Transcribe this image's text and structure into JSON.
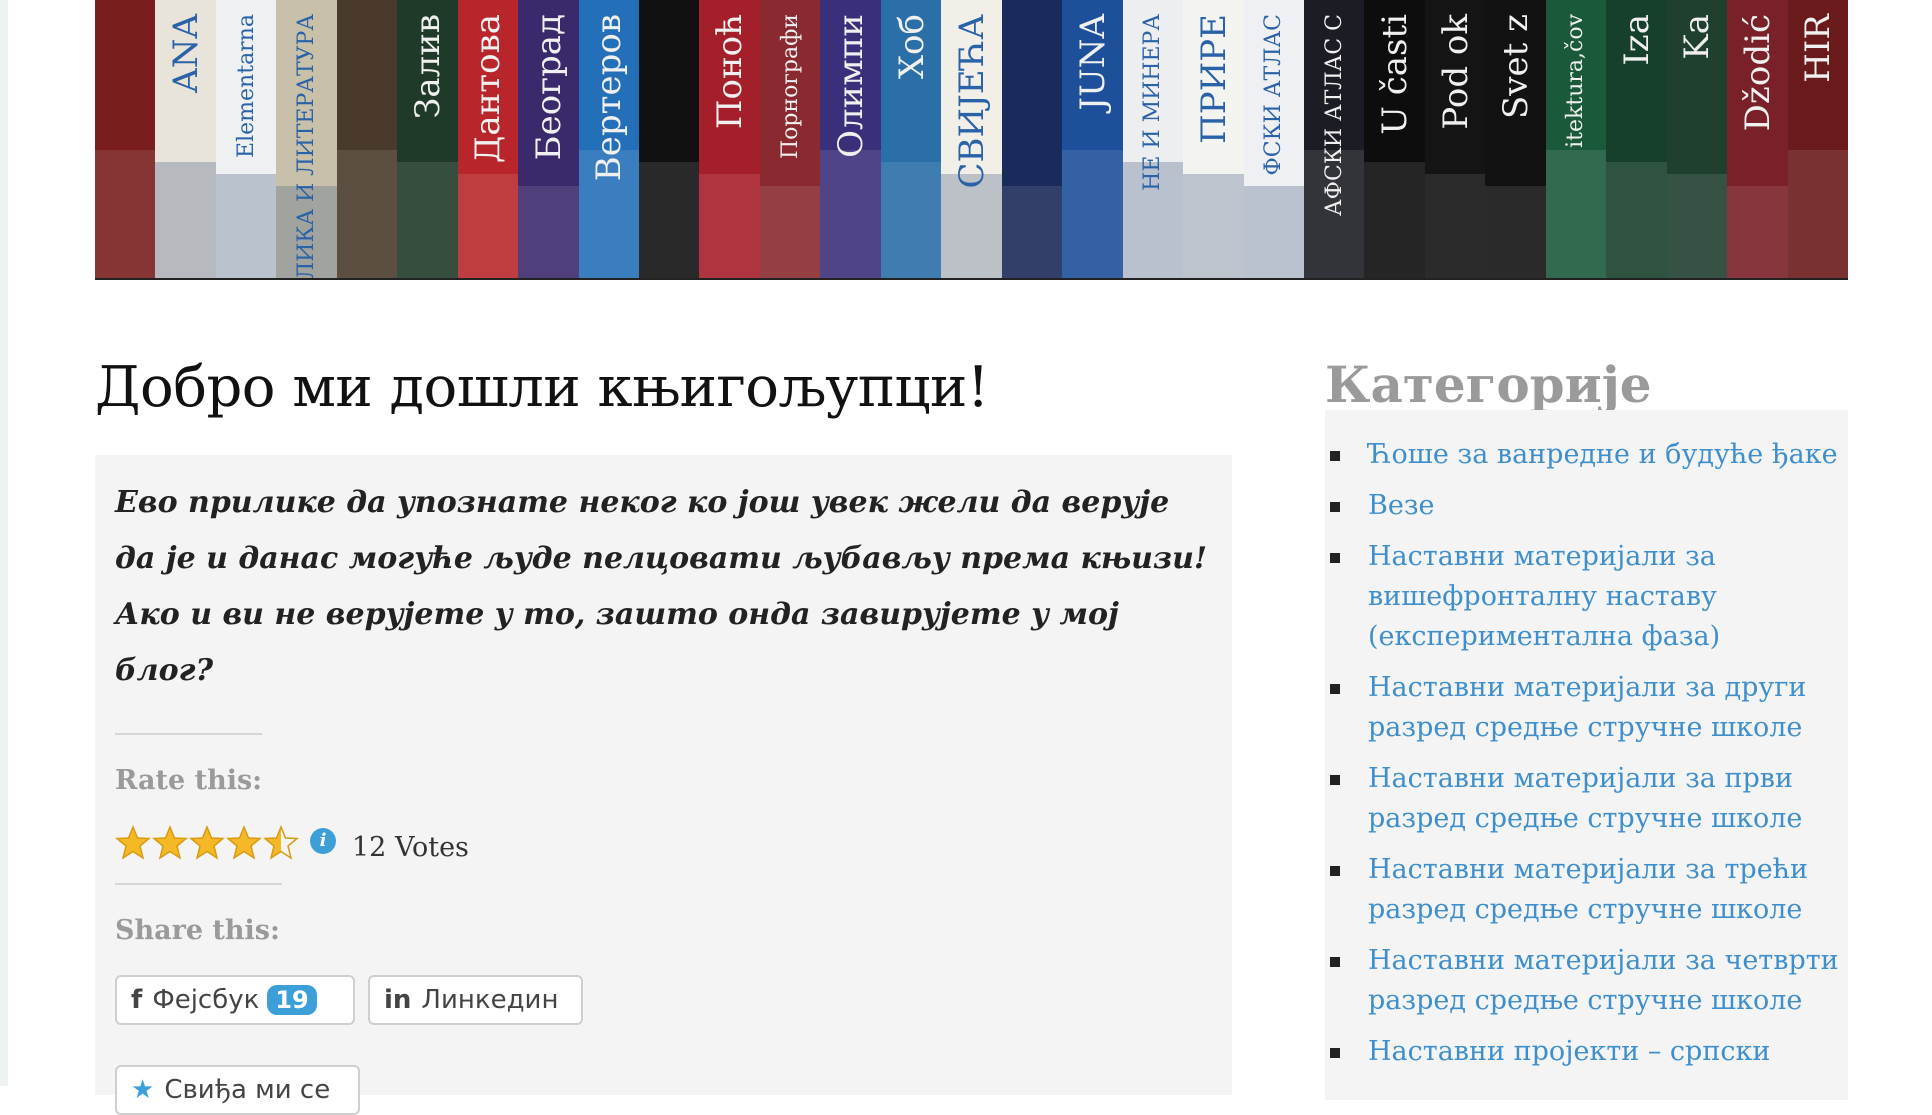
{
  "header": {
    "banner_alt": "book spines",
    "spines": [
      {
        "color": "#7a1d1d",
        "text": ""
      },
      {
        "color": "#e8e4da",
        "text": "ANA"
      },
      {
        "color": "#eef0f2",
        "text": "Elementarna"
      },
      {
        "color": "#c8c0a8",
        "text": "ЛИКА И ЛИТЕРАТУРА"
      },
      {
        "color": "#4a3a2c",
        "text": ""
      },
      {
        "color": "#1f3a28",
        "text": "Залив"
      },
      {
        "color": "#b8262b",
        "text": "Дантова"
      },
      {
        "color": "#3b2a6b",
        "text": "Београд"
      },
      {
        "color": "#2470b8",
        "text": "Вертеров"
      },
      {
        "color": "#111111",
        "text": ""
      },
      {
        "color": "#a51f2a",
        "text": "Поноћ"
      },
      {
        "color": "#8a2a30",
        "text": "Порнографи"
      },
      {
        "color": "#3a2f7a",
        "text": "Олимпи"
      },
      {
        "color": "#2a6fa8",
        "text": "Хоб"
      },
      {
        "color": "#f2efe8",
        "text": "СВИЈЕЋА"
      },
      {
        "color": "#1a2a5a",
        "text": ""
      },
      {
        "color": "#1e4f9a",
        "text": "JUNA"
      },
      {
        "color": "#eceef0",
        "text": "НЕ И МИНЕРА"
      },
      {
        "color": "#f3f3f0",
        "text": "ПРИРЕ"
      },
      {
        "color": "#eef0f3",
        "text": "ФСКИ АТЛАС"
      },
      {
        "color": "#1c1c24",
        "text": "АФСКИ АТЛАС С"
      },
      {
        "color": "#0d0d0d",
        "text": "U časti"
      },
      {
        "color": "#141414",
        "text": "Pod ok"
      },
      {
        "color": "#121212",
        "text": "Svet z"
      },
      {
        "color": "#1a5a3a",
        "text": "itektura,čov"
      },
      {
        "color": "#17402c",
        "text": "Iza"
      },
      {
        "color": "#1f3f2f",
        "text": "Ka"
      },
      {
        "color": "#7a2028",
        "text": "Džodić"
      },
      {
        "color": "#6a1a1a",
        "text": "HIR"
      }
    ]
  },
  "post": {
    "title": "Добро ми дошли књигољупци!",
    "intro": "Ево прилике да упознате неког ко још увек жели да верује да је и данас могуће људе пелцовати љубављу према књизи! Ако и ви не верујете у то, зашто онда завирујете у мој блог?",
    "rating": {
      "label": "Rate this:",
      "stars_filled": 4.5,
      "stars_total": 5,
      "info_icon": "i",
      "votes_text": "12 Votes"
    },
    "share": {
      "label": "Share this:",
      "buttons": [
        {
          "icon": "facebook-icon",
          "glyph": "f",
          "label": "Фејсбук",
          "count": "19"
        },
        {
          "icon": "linkedin-icon",
          "glyph": "in",
          "label": "Линкедин"
        }
      ]
    },
    "like": {
      "icon": "star-icon",
      "glyph": "★",
      "label": "Свиђа ми се"
    }
  },
  "sidebar": {
    "title": "Категорије",
    "categories": [
      "Ћоше за ванредне и будуће ђаке",
      "Везе",
      "Наставни материјали за вишефронталну наставу (експериментална фаза)",
      "Наставни материјали за други разред средње стручне школе",
      "Наставни материјали за први разред средње стручне школе",
      "Наставни материјали за трећи разред средње стручне школе",
      "Наставни материјали за четврти разред средње стручне школе",
      "Наставни пројекти – српски"
    ]
  },
  "colors": {
    "link": "#3f8fcd",
    "muted": "#9a9a9a",
    "panel": "#f4f4f4",
    "badge": "#3d9fd8",
    "star": "#f5b928"
  }
}
